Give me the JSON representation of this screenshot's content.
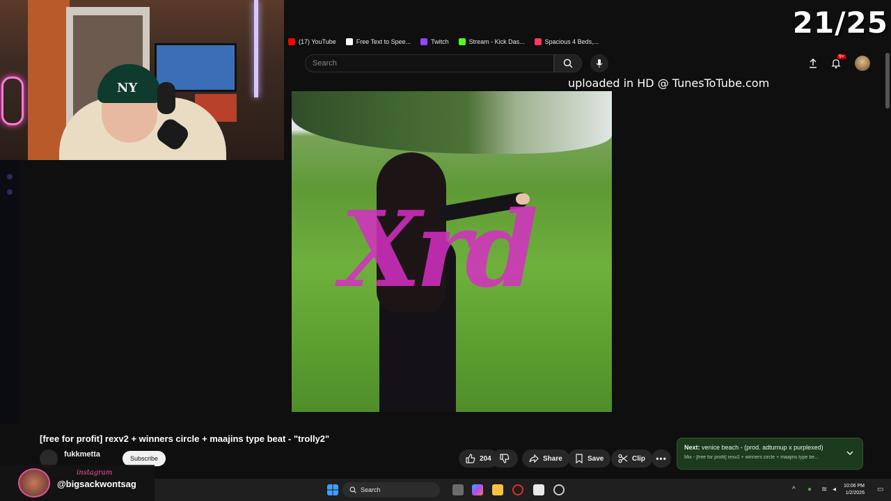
{
  "stream_overlay": {
    "score": "21/25",
    "instagram_label": "instagram",
    "instagram_handle": "@bigsackwontsag"
  },
  "bookmarks": [
    {
      "label": "(17) YouTube",
      "color": "#ff0000"
    },
    {
      "label": "Free Text to Spee...",
      "color": "#ffffff"
    },
    {
      "label": "Twitch",
      "color": "#9146ff"
    },
    {
      "label": "Stream - Kick Das...",
      "color": "#53fc18"
    },
    {
      "label": "Spacious 4 Beds,...",
      "color": "#ff385c"
    }
  ],
  "header": {
    "search_placeholder": "Search",
    "notification_badge": "9+"
  },
  "video": {
    "watermark": "uploaded in HD @ TunesToTube.com",
    "cover_text": "Xrd",
    "title": "[free for profit] rexv2 + winners circle + maajins type beat - \"trolly2\"",
    "channel": "fukkmetta",
    "subscribe_label": "Subscribe",
    "likes": "204",
    "share_label": "Share",
    "save_label": "Save",
    "clip_label": "Clip"
  },
  "next": {
    "prefix": "Next:",
    "title": "venice beach - (prod. adturnup x purplexed)",
    "subtitle": "Mix - [free for profit] rexv2 + winners circle + maajins type be..."
  },
  "taskbar": {
    "search_label": "Search",
    "time": "10:06 PM",
    "date": "1/2/2026"
  },
  "colors": {
    "accent_red": "#cc0000",
    "next_box_bg": "#1c3a1d",
    "cover_text": "#d62fc4"
  }
}
